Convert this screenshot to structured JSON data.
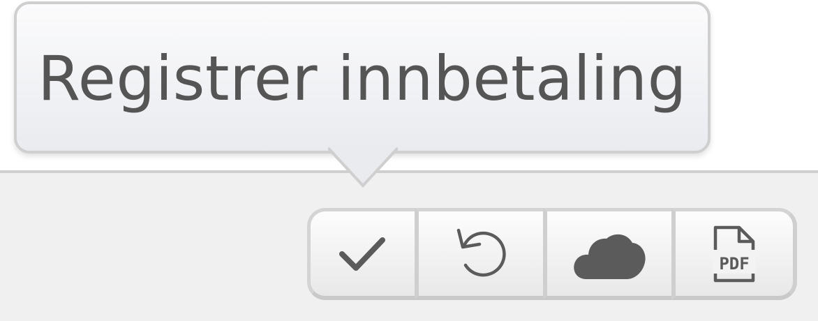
{
  "tooltip": {
    "text": "Registrer innbetaling"
  },
  "toolbar": {
    "buttons": [
      {
        "name": "confirm",
        "icon": "checkmark-icon"
      },
      {
        "name": "undo",
        "icon": "undo-icon"
      },
      {
        "name": "cloud",
        "icon": "cloud-icon"
      },
      {
        "name": "pdf",
        "icon": "pdf-document-icon",
        "icon_text": "PDF"
      }
    ]
  },
  "colors": {
    "icon": "#5b5b5b",
    "tooltip_text": "#555555",
    "panel_background": "#f0f0f0",
    "border": "#cfcfcf"
  }
}
